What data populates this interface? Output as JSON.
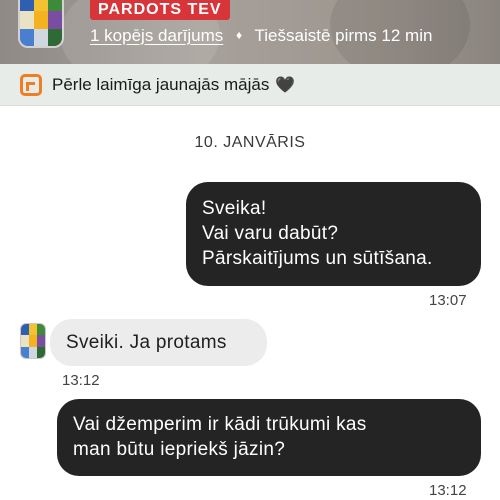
{
  "header": {
    "status": "PARDOTS TEV",
    "transactions_link": "1 kopējs darījums",
    "separator": "♦",
    "online_status": "Tiešsaistē pirms 12 min"
  },
  "banner": {
    "text": "Pērle laimīga jaunajās mājās",
    "heart": "🖤",
    "icon": "package-icon",
    "accent_color": "#ef7d21"
  },
  "chat": {
    "date": "10. JANVĀRIS",
    "messages": [
      {
        "direction": "out",
        "lines": [
          "Sveika!",
          "Vai varu dabūt?",
          "Pārskaitījums un sūtīšana."
        ],
        "time": "13:07"
      },
      {
        "direction": "in",
        "lines": [
          "Sveiki. Ja protams"
        ],
        "time": "13:12"
      },
      {
        "direction": "out",
        "lines": [
          "Vai džemperim ir kādi trūkumi kas",
          "man būtu iepriekš jāzin?"
        ],
        "time": "13:12"
      }
    ]
  },
  "colors": {
    "status_badge": "#d8353b",
    "outgoing_bubble": "#242424",
    "incoming_bubble": "#ececec"
  }
}
